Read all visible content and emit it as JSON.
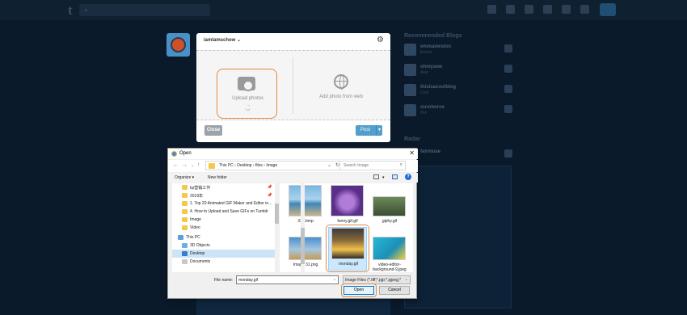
{
  "tumblr": {
    "logo": "t",
    "username": "iamlamschow",
    "upload_label": "Upload photos",
    "web_label": "Add photo from web",
    "close_label": "Close",
    "post_label": "Post",
    "sidebar_title": "Recommended Blogs",
    "sidebar_radar": "Radar",
    "sidebar_items": [
      {
        "name": "emmaweston",
        "sub": "Emma"
      },
      {
        "name": "ohmyawe",
        "sub": "Awe"
      },
      {
        "name": "thisisacoolblog",
        "sub": "Cool"
      },
      {
        "name": "ouroboros",
        "sub": "Oro"
      }
    ],
    "radar_user": "fairmuse"
  },
  "dialog": {
    "title": "Open",
    "breadcrumbs": "This PC  ›  Desktop  ›  files  ›  Image",
    "search_placeholder": "Search Image",
    "organize": "Organize ▾",
    "new_folder": "New folder",
    "nav_items": [
      {
        "label": "kp营销工作",
        "pin": true
      },
      {
        "label": "2019年",
        "pin": true
      },
      {
        "label": "1. Top 20 Animated GIF Maker and Editor in...",
        "pin": false
      },
      {
        "label": "4. How to Upload and Save GIFs on Tumblr",
        "pin": false
      },
      {
        "label": "Image",
        "pin": false
      },
      {
        "label": "Video",
        "pin": false
      },
      {
        "label": "This PC",
        "pin": false
      },
      {
        "label": "3D Objects",
        "pin": false
      },
      {
        "label": "Desktop",
        "pin": false
      },
      {
        "label": "Documents",
        "pin": false
      }
    ],
    "files": [
      {
        "name": "333.bmp"
      },
      {
        "name": "funny.gif.gif"
      },
      {
        "name": "giphy.gif"
      },
      {
        "name": "Image 31.png"
      },
      {
        "name": "monday.gif"
      },
      {
        "name": "video-editor-background-9.jpeg"
      }
    ],
    "file_name_label": "File name:",
    "file_name_value": "monday.gif",
    "filter_value": "Image Files (*.tiff;*.pjp;*.pjpeg;*",
    "open_label": "Open",
    "cancel_label": "Cancel"
  },
  "colors": {
    "accent": "#e08a40",
    "tumblr_blue": "#529ecc",
    "background": "#0b1a2b"
  }
}
